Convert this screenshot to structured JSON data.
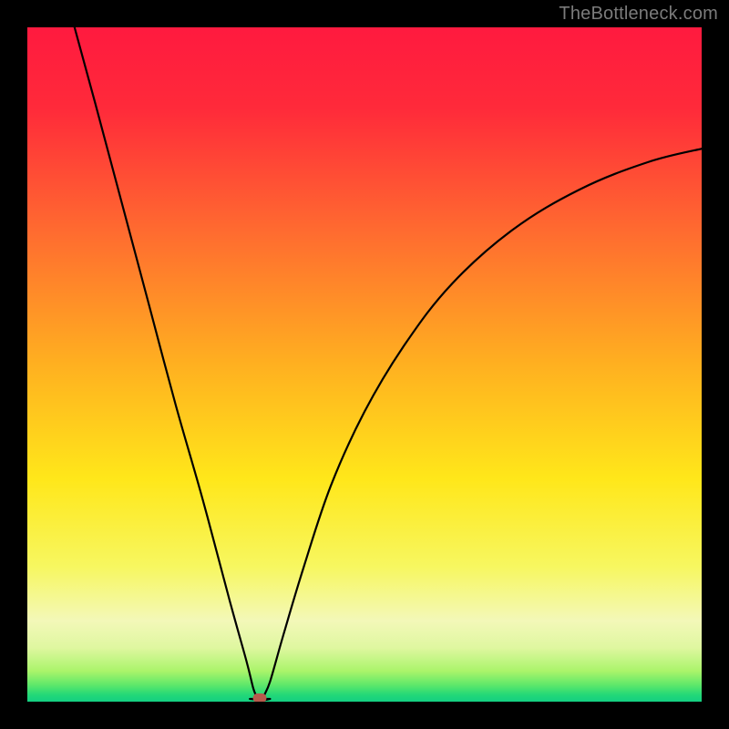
{
  "watermark": "TheBottleneck.com",
  "colors": {
    "marker": "#b85a4c",
    "curve": "#000000"
  },
  "chart_data": {
    "type": "line",
    "title": "",
    "xlabel": "",
    "ylabel": "",
    "xlim": [
      0,
      100
    ],
    "ylim": [
      0,
      100
    ],
    "optimal": {
      "x": 34.5,
      "y": 0
    },
    "left_branch": [
      {
        "x": 7.0,
        "y": 100.0
      },
      {
        "x": 10.0,
        "y": 89.0
      },
      {
        "x": 14.0,
        "y": 74.0
      },
      {
        "x": 18.0,
        "y": 59.0
      },
      {
        "x": 22.0,
        "y": 44.0
      },
      {
        "x": 26.0,
        "y": 30.0
      },
      {
        "x": 30.0,
        "y": 15.0
      },
      {
        "x": 32.5,
        "y": 6.0
      },
      {
        "x": 33.5,
        "y": 2.0
      },
      {
        "x": 34.0,
        "y": 0.5
      }
    ],
    "right_branch": [
      {
        "x": 35.0,
        "y": 0.5
      },
      {
        "x": 36.0,
        "y": 3.0
      },
      {
        "x": 38.0,
        "y": 10.0
      },
      {
        "x": 41.0,
        "y": 20.0
      },
      {
        "x": 45.0,
        "y": 32.0
      },
      {
        "x": 50.0,
        "y": 43.0
      },
      {
        "x": 56.0,
        "y": 53.0
      },
      {
        "x": 63.0,
        "y": 62.0
      },
      {
        "x": 72.0,
        "y": 70.0
      },
      {
        "x": 82.0,
        "y": 76.0
      },
      {
        "x": 92.0,
        "y": 80.0
      },
      {
        "x": 100.0,
        "y": 82.0
      }
    ]
  }
}
